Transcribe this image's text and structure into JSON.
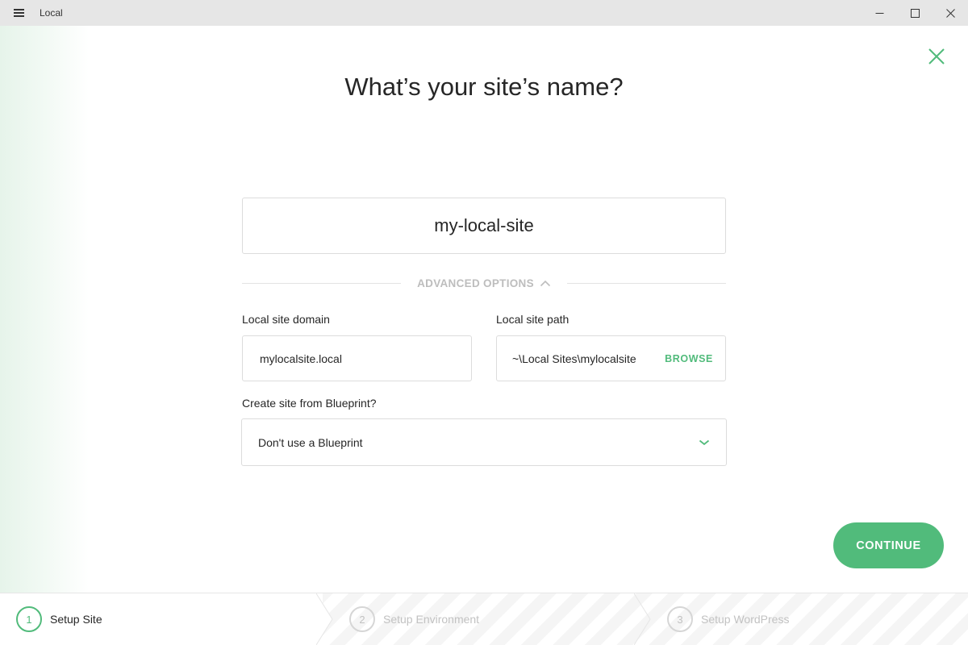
{
  "window": {
    "app_title": "Local"
  },
  "page": {
    "title": "What’s your site’s name?",
    "site_name_value": "my-local-site"
  },
  "advanced_options": {
    "label": "ADVANCED OPTIONS",
    "expanded": true
  },
  "domain_field": {
    "label": "Local site domain",
    "value": "mylocalsite.local"
  },
  "path_field": {
    "label": "Local site path",
    "value": "~\\Local Sites\\mylocalsite",
    "browse_label": "BROWSE"
  },
  "blueprint_field": {
    "label": "Create site from Blueprint?",
    "selected": "Don't use a Blueprint"
  },
  "continue_label": "CONTINUE",
  "steps": [
    {
      "number": "1",
      "label": "Setup Site",
      "active": true
    },
    {
      "number": "2",
      "label": "Setup Environment",
      "active": false
    },
    {
      "number": "3",
      "label": "Setup WordPress",
      "active": false
    }
  ],
  "colors": {
    "accent": "#51bb7b",
    "muted": "#c2c2c2",
    "titlebar": "#e6e6e6"
  },
  "icons": {
    "menu": "hamburger-icon",
    "minimize": "minimize-icon",
    "maximize": "maximize-icon",
    "close_window": "close-window-icon",
    "close_modal": "close-icon",
    "advanced_toggle": "chevron-up-icon",
    "blueprint_dropdown": "chevron-down-icon"
  }
}
